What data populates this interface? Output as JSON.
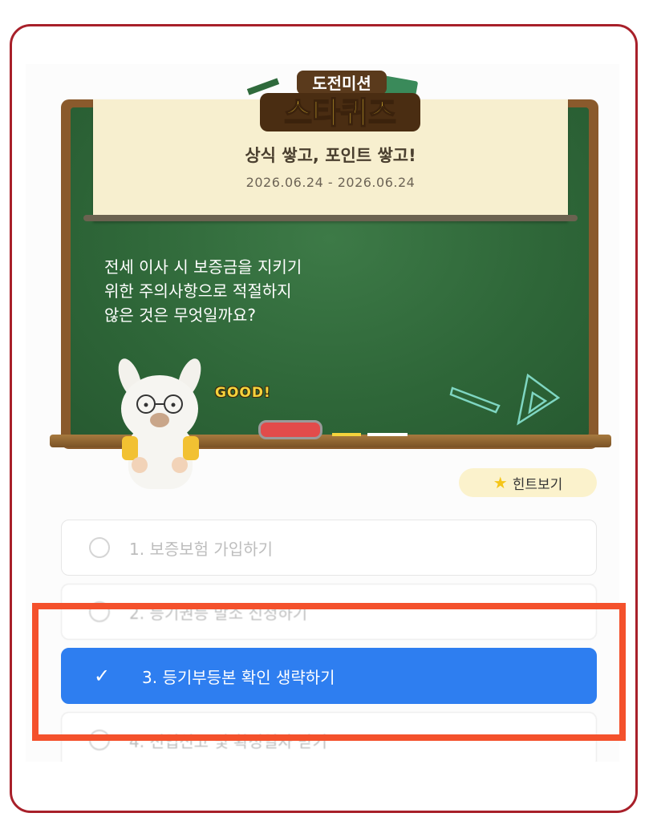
{
  "event": {
    "badge_top": "도전미션",
    "badge_main": "스타퀴즈",
    "subtitle": "상식 쌓고, 포인트 쌓고!",
    "period": "2026.06.24 - 2026.06.24"
  },
  "question": {
    "lines": [
      "전세 이사 시 보증금을 지키기",
      "위한 주의사항으로 적절하지",
      "않은 것은 무엇일까요?"
    ]
  },
  "decor": {
    "good": "GOOD!"
  },
  "hint": {
    "label": "힌트보기",
    "icon": "star-icon"
  },
  "options": [
    {
      "label": "1. 보증보험 가입하기",
      "state": "default"
    },
    {
      "label": "2. 등기권등 말소 신청하기",
      "state": "default"
    },
    {
      "label": "3. 등기부등본 확인 생략하기",
      "state": "selected"
    },
    {
      "label": "4. 전입신고 및 확정일자 받기",
      "state": "default"
    }
  ],
  "colors": {
    "accent": "#2e7ef0",
    "highlight": "#f4512c",
    "frame": "#a8202a",
    "board": "#2e6638"
  }
}
